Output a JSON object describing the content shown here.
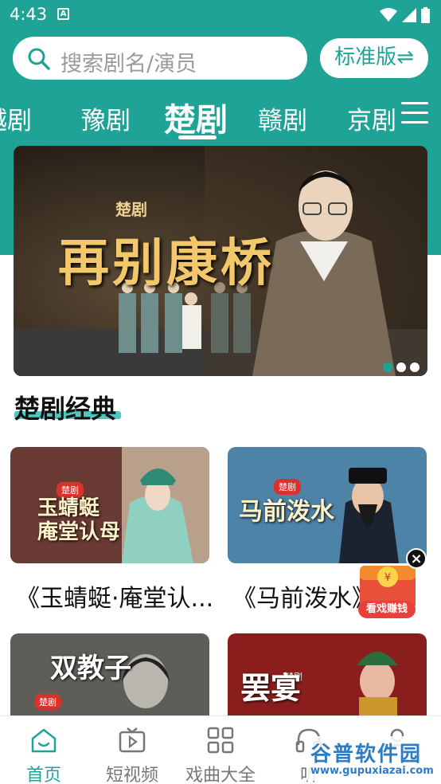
{
  "status_bar": {
    "time": "4:43",
    "notification_letter": "A"
  },
  "search": {
    "placeholder": "搜索剧名/演员"
  },
  "version_button": {
    "label": "标准版⇌"
  },
  "tabs": [
    {
      "label": "越剧"
    },
    {
      "label": "豫剧"
    },
    {
      "label": "楚剧",
      "active": true
    },
    {
      "label": "赣剧"
    },
    {
      "label": "京剧"
    }
  ],
  "banner": {
    "small_label": "楚剧",
    "title": "再别康桥",
    "dots": 3,
    "active_dot": 0
  },
  "section": {
    "title": "楚剧经典"
  },
  "cards": [
    {
      "label": "《玉蜻蜓·庵堂认...",
      "thumb_text": "玉蜻蜓\n庵堂认母",
      "badge": "楚剧"
    },
    {
      "label": "《马前泼水》",
      "thumb_text": "马前泼水",
      "badge": "楚剧"
    },
    {
      "label": "",
      "thumb_text": "双教子",
      "badge": "楚剧"
    },
    {
      "label": "",
      "thumb_text": "罢宴",
      "badge": "楚剧"
    }
  ],
  "float_badge": {
    "label": "看戏赚钱",
    "close": "×"
  },
  "bottom_nav": [
    {
      "label": "首页",
      "icon": "home-icon",
      "active": true
    },
    {
      "label": "短视频",
      "icon": "video-icon"
    },
    {
      "label": "戏曲大全",
      "icon": "grid-icon"
    },
    {
      "label": "听",
      "icon": "headphones-icon"
    },
    {
      "label": "",
      "icon": "profile-icon"
    }
  ],
  "watermark": {
    "big": "谷普软件园",
    "small": "www.gupuxiazai.com"
  },
  "colors": {
    "accent": "#20a397",
    "highlight": "#4fc7bf"
  }
}
